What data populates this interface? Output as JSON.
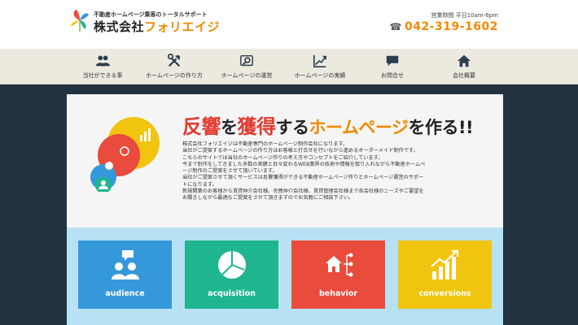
{
  "header": {
    "tagline": "不動産ホームページ集客のトータルサポート",
    "company_prefix": "株式会社",
    "company_name": "フォリエイジ",
    "hours": "営業時間 平日10am-6pm",
    "phone": "042-319-1602"
  },
  "nav": [
    {
      "label": "当社ができる事",
      "icon": "users-icon"
    },
    {
      "label": "ホームページの作り方",
      "icon": "tools-icon"
    },
    {
      "label": "ホームページの運営",
      "icon": "search-icon"
    },
    {
      "label": "ホームページの実績",
      "icon": "growth-chart-icon"
    },
    {
      "label": "お問合せ",
      "icon": "speech-bubble-icon"
    },
    {
      "label": "会社概要",
      "icon": "home-icon"
    }
  ],
  "hero": {
    "headline": {
      "part1": "反響",
      "part2": "を",
      "part3": "獲得",
      "part4": "する",
      "part5": "ホームページ",
      "part6": "を作る!!"
    },
    "intro": [
      "株式会社フォリエイジは不動産専門のホームページ制作会社になります。",
      "当社がご提案するホームページの作り方はお客様と打合せを行いながら進めるオーダーメイド制作です。",
      "こちらのサイトでは当社のホームページ作りの考え方やコンセプトをご紹介しています。",
      "今まで制作をしてきました多数の実績と日々変わるWEB業界の技術や情報を取り入れながら不動産ホームペ",
      "ージ制作のご提案をさせて頂いています。",
      "当社がご提案させて頂くサービスは反響獲得ができる不動産ホームページ作りとホームページ運営のサポー",
      "トになります。",
      "新規開業のお客様から賃貸仲介会社様、売買仲介会社様、賃貸管理会社様まで各会社様のニーズやご要望を",
      "お聞きしながら最適なご提案をさせて頂きますのでお気軽にご相談下さい。"
    ]
  },
  "tiles": [
    {
      "label": "audience",
      "icon": "audience-icon",
      "color": "#3598db"
    },
    {
      "label": "acquisition",
      "icon": "pie-chart-icon",
      "color": "#1fb58f"
    },
    {
      "label": "behavior",
      "icon": "sitemap-icon",
      "color": "#e94b3c"
    },
    {
      "label": "conversions",
      "icon": "conversions-chart-icon",
      "color": "#f1c40f"
    }
  ],
  "colors": {
    "accent_orange": "#f08a00",
    "accent_red": "#e23a2e",
    "nav_bg": "#ece9df",
    "page_bg": "#223240",
    "tiles_band": "#b8e2f4"
  }
}
